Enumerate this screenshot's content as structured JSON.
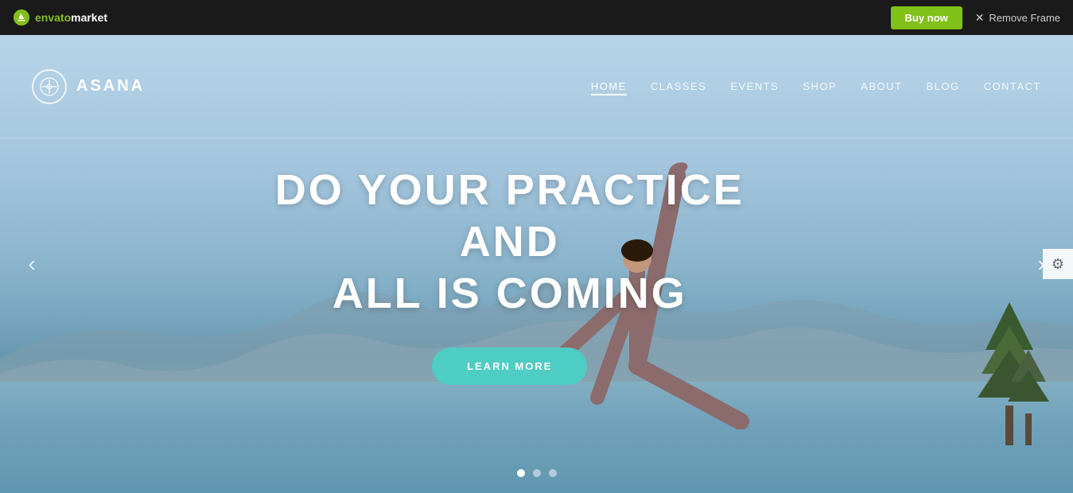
{
  "topbar": {
    "brand_envato": "envato",
    "brand_market": "market",
    "buy_now_label": "Buy now",
    "remove_frame_label": "Remove Frame"
  },
  "nav": {
    "logo_name": "ASANA",
    "links": [
      {
        "label": "HOME",
        "active": true
      },
      {
        "label": "CLASSES",
        "active": false
      },
      {
        "label": "EVENTS",
        "active": false
      },
      {
        "label": "SHOP",
        "active": false
      },
      {
        "label": "ABOUT",
        "active": false
      },
      {
        "label": "BLOG",
        "active": false
      },
      {
        "label": "CONTACT",
        "active": false
      }
    ]
  },
  "hero": {
    "title_line1": "DO YOUR PRACTICE AND",
    "title_line2": "ALL IS COMING",
    "cta_label": "LEARN MORE"
  },
  "slider": {
    "arrow_left": "‹",
    "arrow_right": "›",
    "dots": [
      {
        "active": true
      },
      {
        "active": false
      },
      {
        "active": false
      }
    ]
  },
  "icons": {
    "gear": "⚙",
    "envato_leaf": "🌿"
  }
}
